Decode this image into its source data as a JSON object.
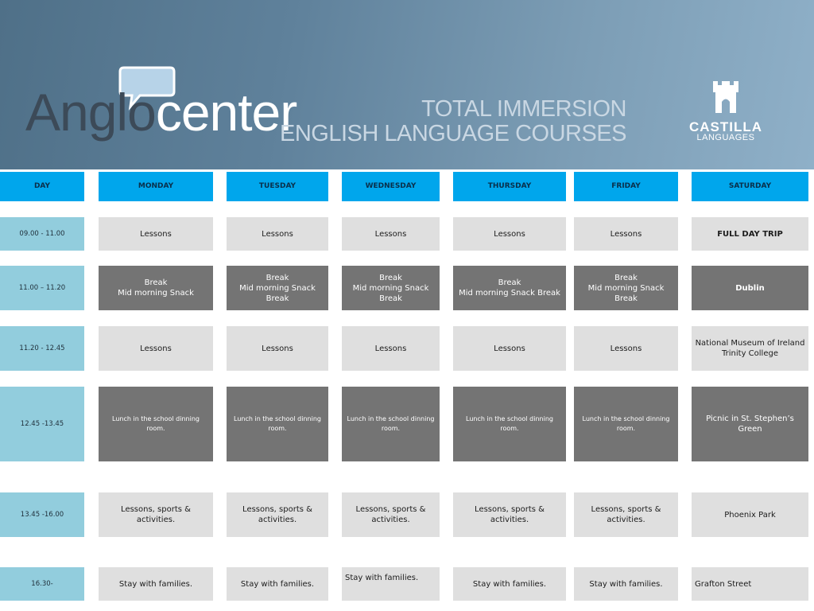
{
  "header": {
    "logo": {
      "part1": "Anglo",
      "part2": "center"
    },
    "headline": {
      "line1": "TOTAL IMMERSION",
      "line2": "ENGLISH LANGUAGE COURSES"
    },
    "partner": {
      "name": "CASTILLA",
      "sub": "LANGUAGES"
    }
  },
  "schedule": {
    "columns": [
      "DAY",
      "MONDAY",
      "TUESDAY",
      "WEDNESDAY",
      "THURSDAY",
      "FRIDAY",
      "SATURDAY"
    ],
    "rows": [
      {
        "time": "09.00 - 11.00",
        "cells": [
          "Lessons",
          "Lessons",
          "Lessons",
          "Lessons",
          "Lessons",
          "FULL DAY TRIP"
        ]
      },
      {
        "time": "11.00 – 11.20",
        "cells": [
          [
            "Break",
            "Mid morning Snack"
          ],
          [
            "Break",
            "Mid morning Snack Break"
          ],
          [
            "Break",
            "Mid morning Snack",
            "Break"
          ],
          [
            "Break",
            "Mid morning Snack Break"
          ],
          [
            "Break",
            "Mid morning Snack Break"
          ],
          "Dublin"
        ]
      },
      {
        "time": "11.20 - 12.45",
        "cells": [
          "Lessons",
          "Lessons",
          "Lessons",
          "Lessons",
          "Lessons",
          [
            "National Museum of Ireland",
            "Trinity College"
          ]
        ]
      },
      {
        "time": "12.45 -13.45",
        "cells": [
          [
            "Lunch in the school dinning",
            "room."
          ],
          [
            "Lunch in the school dinning",
            "room."
          ],
          [
            "Lunch in the school dinning",
            "room."
          ],
          [
            "Lunch in the school dinning",
            "room."
          ],
          [
            "Lunch in the school dinning",
            "room."
          ],
          "Picnic in St. Stephen’s Green"
        ]
      },
      {
        "time": "13.45 -16.00",
        "cells": [
          "Lessons, sports & activities.",
          [
            "Lessons, sports &",
            "activities."
          ],
          [
            "Lessons, sports &",
            "activities."
          ],
          "Lessons, sports & activities.",
          [
            "Lessons, sports &",
            "activities."
          ],
          "Phoenix Park"
        ]
      },
      {
        "time": "16.30-",
        "cells": [
          "Stay with families.",
          "Stay with families.",
          "Stay with families.",
          "Stay with families.",
          "Stay with families.",
          "Grafton Street"
        ]
      }
    ]
  }
}
